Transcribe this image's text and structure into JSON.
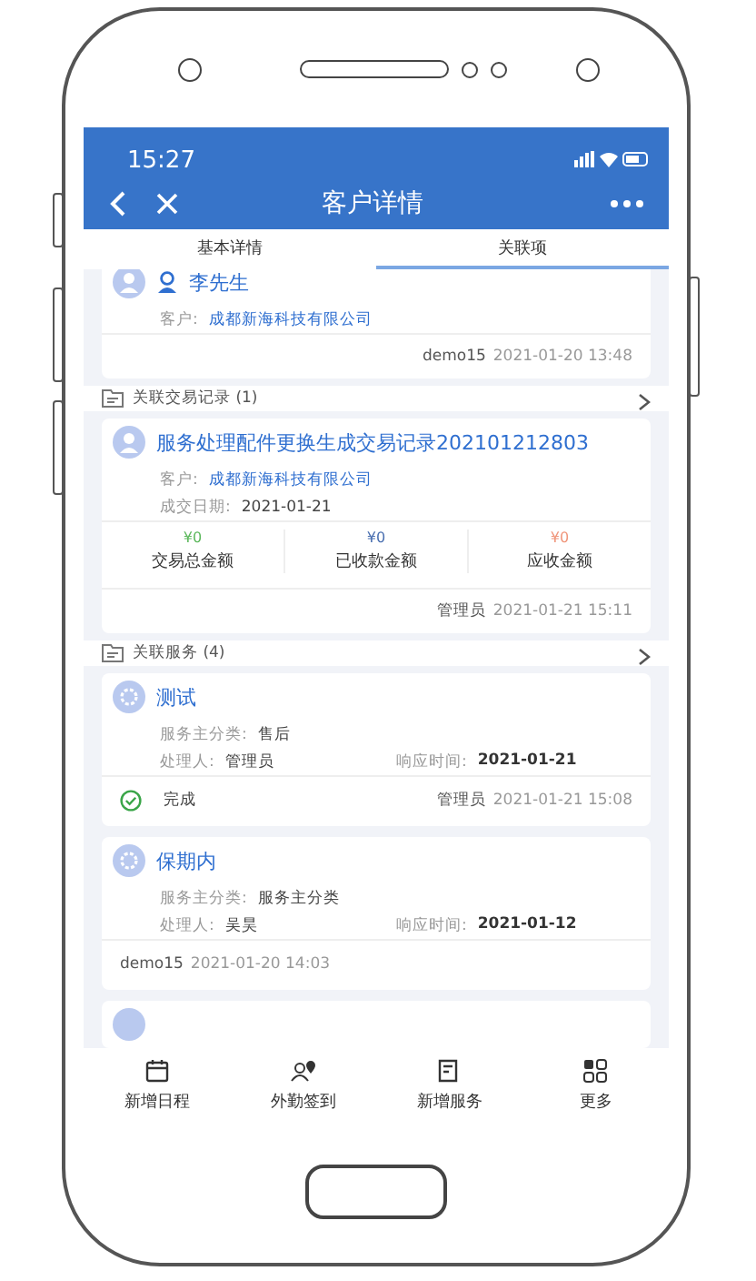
{
  "status_bar": {
    "time": "15:27"
  },
  "nav": {
    "title": "客户详情"
  },
  "tabs": [
    {
      "label": "基本详情",
      "selected": false
    },
    {
      "label": "关联项",
      "selected": true
    }
  ],
  "contact": {
    "name": "李先生",
    "customer_label": "客户:",
    "customer": "成都新海科技有限公司",
    "user": "demo15",
    "time": "2021-01-20 13:48"
  },
  "transactions_header": {
    "title": "关联交易记录 (1)"
  },
  "transaction": {
    "title": "服务处理配件更换生成交易记录202101212803",
    "customer_label": "客户:",
    "customer": "成都新海科技有限公司",
    "date_label": "成交日期:",
    "date": "2021-01-21",
    "amounts": [
      {
        "value": "¥0",
        "label": "交易总金额",
        "color": "#5cb85c"
      },
      {
        "value": "¥0",
        "label": "已收款金额",
        "color": "#4a6fb0"
      },
      {
        "value": "¥0",
        "label": "应收金额",
        "color": "#f0957a"
      }
    ],
    "user": "管理员",
    "time": "2021-01-21 15:11"
  },
  "services_header": {
    "title": "关联服务 (4)"
  },
  "services": [
    {
      "title": "测试",
      "category_label": "服务主分类:",
      "category": "售后",
      "handler_label": "处理人:",
      "handler": "管理员",
      "response_label": "响应时间:",
      "response": "2021-01-21",
      "status": "完成",
      "user": "管理员",
      "time": "2021-01-21 15:08"
    },
    {
      "title": "保期内",
      "category_label": "服务主分类:",
      "category": "服务主分类",
      "handler_label": "处理人:",
      "handler": "吴昊",
      "response_label": "响应时间:",
      "response": "2021-01-12",
      "user": "demo15",
      "time": "2021-01-20 14:03"
    }
  ],
  "bottom_bar": [
    {
      "kind": "calendar",
      "label": "新增日程"
    },
    {
      "kind": "checkin",
      "label": "外勤签到"
    },
    {
      "kind": "document",
      "label": "新增服务"
    },
    {
      "kind": "grid",
      "label": "更多"
    }
  ]
}
